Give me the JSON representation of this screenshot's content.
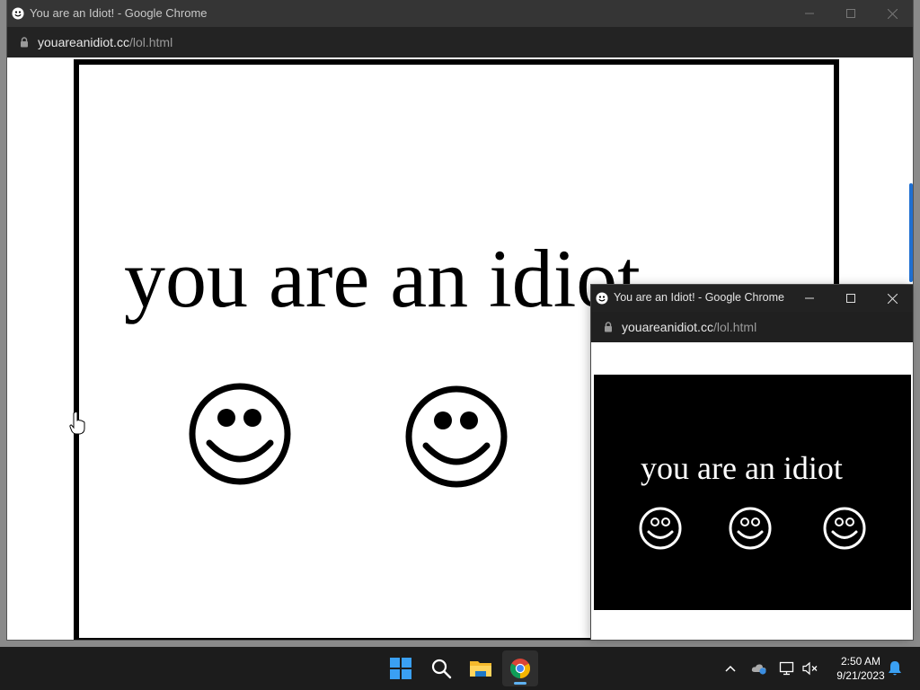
{
  "main_window": {
    "title": "You are an Idiot! - Google Chrome",
    "url_host": "youareanidiot.cc",
    "url_path": "/lol.html",
    "page_text": "you are an idiot"
  },
  "popup_window": {
    "title": "You are an Idiot! - Google Chrome",
    "url_host": "youareanidiot.cc",
    "url_path": "/lol.html",
    "page_text": "you are an idiot"
  },
  "taskbar": {
    "apps": [
      "start-icon",
      "search-icon",
      "file-explorer-icon",
      "chrome-icon"
    ],
    "tray_icons": [
      "chevron-up-icon",
      "onedrive-icon",
      "network-icon",
      "volume-muted-icon",
      "notification-bell-icon"
    ],
    "clock_time": "2:50 AM",
    "clock_date": "9/21/2023"
  }
}
